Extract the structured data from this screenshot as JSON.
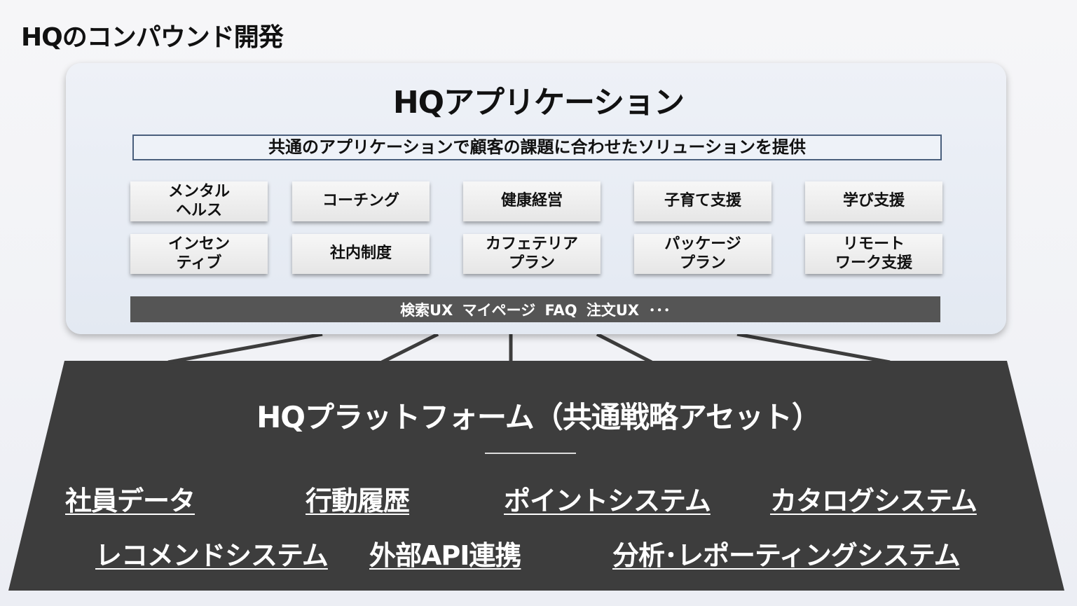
{
  "page_title": "HQのコンパウンド開発",
  "application": {
    "title": "HQアプリケーション",
    "description": "共通のアプリケーションで顧客の課題に合わせたソリューションを提供",
    "solutions_row1": [
      {
        "line1": "メンタル",
        "line2": "ヘルス"
      },
      {
        "line1": "コーチング",
        "line2": ""
      },
      {
        "line1": "健康経営",
        "line2": ""
      },
      {
        "line1": "子育て支援",
        "line2": ""
      },
      {
        "line1": "学び支援",
        "line2": ""
      }
    ],
    "solutions_row2": [
      {
        "line1": "インセン",
        "line2": "ティブ"
      },
      {
        "line1": "社内制度",
        "line2": ""
      },
      {
        "line1": "カフェテリア",
        "line2": "プラン"
      },
      {
        "line1": "パッケージ",
        "line2": "プラン"
      },
      {
        "line1": "リモート",
        "line2": "ワーク支援"
      }
    ],
    "ux_bar": "検索UX マイページ FAQ 注文UX ･･･"
  },
  "platform": {
    "title": "HQプラットフォーム（共通戦略アセット）",
    "assets_row1": [
      "社員データ",
      "行動履歴",
      "ポイントシステム",
      "カタログシステム"
    ],
    "assets_row2": [
      "レコメンドシステム",
      "外部API連携",
      "分析･レポーティングシステム"
    ]
  },
  "colors": {
    "platform_fill": "#3d3d3d",
    "app_box_fill": "#e6ebf3",
    "ux_bar_fill": "#555555",
    "description_border": "#4a5f7d"
  }
}
